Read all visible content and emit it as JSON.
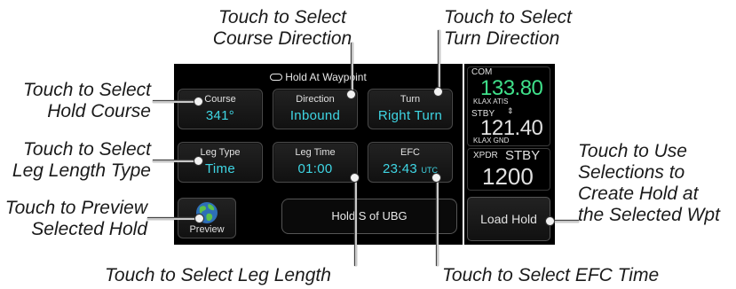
{
  "callouts": {
    "course_direction": [
      "Touch to Select",
      "Course Direction"
    ],
    "turn_direction": [
      "Touch to Select",
      "Turn Direction"
    ],
    "hold_course": [
      "Touch to Select",
      "Hold Course"
    ],
    "leg_type": [
      "Touch to Select",
      "Leg Length Type"
    ],
    "preview": [
      "Touch to Preview",
      "Selected Hold"
    ],
    "use_selections": [
      "Touch to Use",
      "Selections to",
      "Create Hold at",
      "the Selected Wpt"
    ],
    "leg_length": "Touch to Select Leg Length",
    "efc_time": "Touch to Select EFC Time"
  },
  "screen": {
    "title": "Hold At Waypoint",
    "buttons": {
      "course": {
        "label": "Course",
        "value": "341°"
      },
      "direction": {
        "label": "Direction",
        "value": "Inbound"
      },
      "turn": {
        "label": "Turn",
        "value": "Right Turn"
      },
      "leg_type": {
        "label": "Leg Type",
        "value": "Time"
      },
      "leg_time": {
        "label": "Leg Time",
        "value": "01:00"
      },
      "efc": {
        "label": "EFC",
        "value": "23:43",
        "unit": "UTC"
      }
    },
    "preview_label": "Preview",
    "hold_text": "Hold S of UBG"
  },
  "panel": {
    "com_label": "COM",
    "com_active": "133.80",
    "com_active_id": "KLAX ATIS",
    "stby_label": "STBY",
    "stby_freq": "121.40",
    "stby_id": "KLAX GND",
    "xpdr_label": "XPDR",
    "xpdr_mode": "STBY",
    "xpdr_code": "1200",
    "load_hold": "Load Hold"
  },
  "colors": {
    "value_cyan": "#3fd6e4",
    "com_green": "#3fe08a"
  }
}
